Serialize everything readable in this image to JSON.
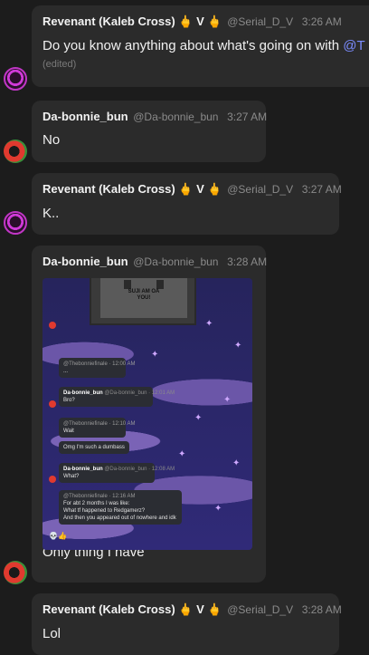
{
  "messages": [
    {
      "name": "Revenant (Kaleb Cross)",
      "emoji_left": "🖕",
      "emoji_mid": "V",
      "emoji_right": "🖕",
      "handle": "@Serial_D_V",
      "time": "3:26 AM",
      "text_before": "Do you know anything about what's going on with ",
      "mention": "@T",
      "edited": "(edited)"
    },
    {
      "name": "Da-bonnie_bun",
      "handle": "@Da-bonnie_bun",
      "time": "3:27 AM",
      "text": "No"
    },
    {
      "name": "Revenant (Kaleb Cross)",
      "emoji_left": "🖕",
      "emoji_mid": "V",
      "emoji_right": "🖕",
      "handle": "@Serial_D_V",
      "time": "3:27 AM",
      "text": "K.."
    },
    {
      "name": "Da-bonnie_bun",
      "handle": "@Da-bonnie_bun",
      "time": "3:28 AM",
      "caption": "Only thing I have",
      "screenshot": {
        "top_art_text": "SUJI AM OA YOU!",
        "chat": [
          {
            "reply": "@Thebonniefinale · 12:00 AM",
            "text": "..."
          },
          {
            "name": "Da-bonnie_bun",
            "meta": "@Da-bonnie_bun · 12:01 AM",
            "text": "Bro?"
          },
          {
            "reply": "@Thebonniefinale · 12:10 AM",
            "text": "Wait"
          },
          {
            "text": "Omg I'm such a dumbass"
          },
          {
            "name": "Da-bonnie_bun",
            "meta": "@Da-bonnie_bun · 12:08 AM",
            "text": "What?"
          },
          {
            "reply": "@Thebonniefinale · 12:16 AM",
            "lines": [
              "For abt 2 months I was like:",
              "What tf happened to Redgamerz?",
              "And then you appeared out of nowhere and idk"
            ]
          }
        ],
        "reaction": "💀👍"
      }
    },
    {
      "name": "Revenant (Kaleb Cross)",
      "emoji_left": "🖕",
      "emoji_mid": "V",
      "emoji_right": "🖕",
      "handle": "@Serial_D_V",
      "time": "3:28 AM",
      "text": "Lol"
    }
  ]
}
